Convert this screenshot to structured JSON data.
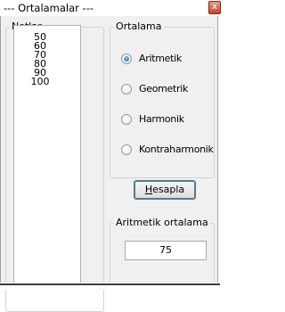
{
  "window": {
    "title": "--- Ortalamalar ---",
    "close_glyph": "x"
  },
  "grades": {
    "label": "Notlar",
    "items": [
      "50",
      "60",
      "70",
      "80",
      "90",
      "100"
    ]
  },
  "average_type": {
    "label": "Ortalama",
    "options": [
      {
        "label": "Aritmetik",
        "checked": true
      },
      {
        "label": "Geometrik",
        "checked": false
      },
      {
        "label": "Harmonik",
        "checked": false
      },
      {
        "label": "Kontraharmonik",
        "checked": false
      }
    ]
  },
  "calculate": {
    "mnemonic": "H",
    "rest": "esapla"
  },
  "result": {
    "label": "Aritmetik ortalama",
    "value": "75"
  }
}
